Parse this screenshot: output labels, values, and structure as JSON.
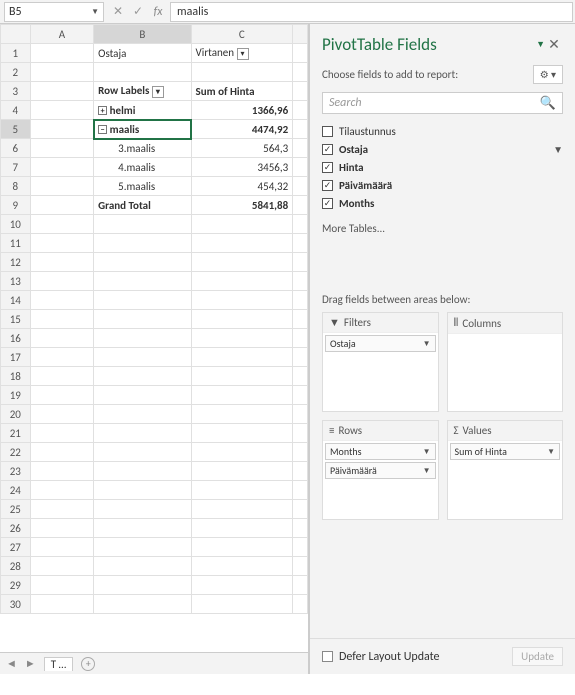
{
  "formula_bar": {
    "name_box": "B5",
    "value": "maalis"
  },
  "columns": [
    "A",
    "B",
    "C"
  ],
  "grid": {
    "b1": "Ostaja",
    "c1": "Virtanen",
    "b3": "Row Labels",
    "c3": "Sum of Hinta",
    "b4": "helmi",
    "c4": "1366,96",
    "b5": "maalis",
    "c5": "4474,92",
    "b6": "3.maalis",
    "c6": "564,3",
    "b7": "4.maalis",
    "c7": "3456,3",
    "b8": "5.maalis",
    "c8": "454,32",
    "b9": "Grand Total",
    "c9": "5841,88"
  },
  "sheet_tab": "T …",
  "task_pane": {
    "title": "PivotTable Fields",
    "subtitle": "Choose fields to add to report:",
    "search_placeholder": "Search",
    "fields": [
      "Tilaustunnus",
      "Ostaja",
      "Hinta",
      "Päivämäärä",
      "Months"
    ],
    "fields_checked": [
      false,
      true,
      true,
      true,
      true
    ],
    "fields_filtered": [
      false,
      true,
      false,
      false,
      false
    ],
    "more": "More Tables...",
    "areas_label": "Drag fields between areas below:",
    "filters_label": "Filters",
    "columns_label": "Columns",
    "rows_label": "Rows",
    "values_label": "Values",
    "filters_items": [
      "Ostaja"
    ],
    "rows_items": [
      "Months",
      "Päivämäärä"
    ],
    "values_items": [
      "Sum of Hinta"
    ],
    "defer": "Defer Layout Update",
    "update": "Update"
  }
}
